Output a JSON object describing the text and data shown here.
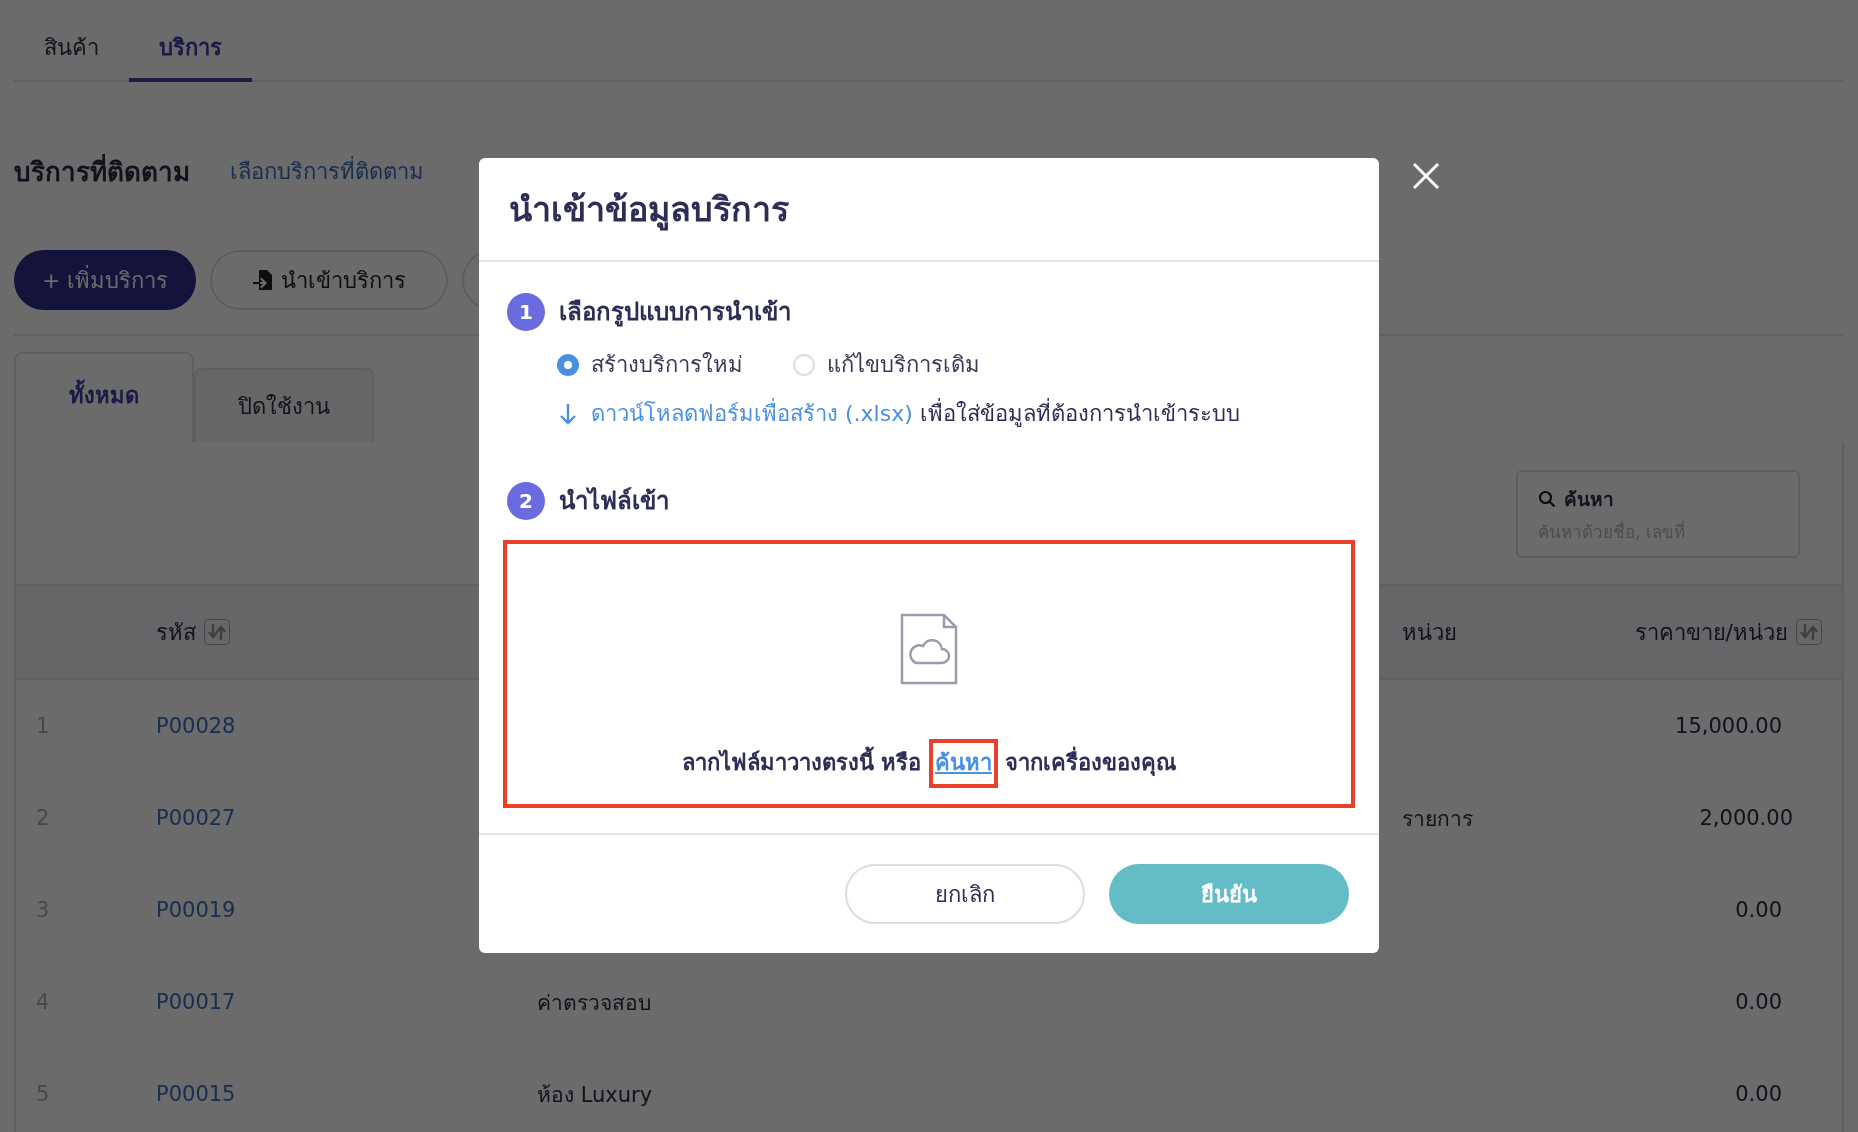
{
  "top_tabs": [
    {
      "label": "สินค้า",
      "selected": false
    },
    {
      "label": "บริการ",
      "selected": true
    }
  ],
  "section": {
    "title": "บริการที่ติดตาม",
    "link": "เลือกบริการที่ติดตาม"
  },
  "toolbar": {
    "add_button": {
      "icon": "+",
      "label": "เพิ่มบริการ"
    },
    "import_button": "นำเข้าบริการ"
  },
  "filter_tabs": [
    {
      "label": "ทั้งหมด",
      "selected": true
    },
    {
      "label": "ปิดใช้งาน",
      "selected": false
    }
  ],
  "search": {
    "label": "ค้นหา",
    "placeholder": "ค้นหาด้วยชื่อ, เลขที่"
  },
  "table": {
    "columns": [
      {
        "kind": "code",
        "label": "รหัส",
        "sortable": true
      },
      {
        "kind": "unit",
        "label": "หน่วย",
        "sortable": false
      },
      {
        "kind": "price",
        "label": "ราคาขาย/หน่วย",
        "sortable": true
      }
    ],
    "rows": [
      {
        "index": "1",
        "code": "P00028",
        "price": "15,000.00"
      },
      {
        "index": "2",
        "code": "P00027",
        "unit": "รายการ",
        "price": "2,000.00"
      },
      {
        "index": "3",
        "code": "P00019",
        "price": "0.00"
      },
      {
        "index": "4",
        "code": "P00017",
        "name": "ค่าตรวจสอบ",
        "price": "0.00"
      },
      {
        "index": "5",
        "code": "P00015",
        "name": "ห้อง Luxury",
        "price": "0.00"
      }
    ]
  },
  "modal": {
    "title": "นำเข้าข้อมูลบริการ",
    "steps": [
      {
        "number": "1",
        "title": "เลือกรูปแบบการนำเข้า"
      },
      {
        "number": "2",
        "title": "นำไฟล์เข้า"
      }
    ],
    "options": [
      {
        "label": "สร้างบริการใหม่",
        "selected": true
      },
      {
        "label": "แก้ไขบริการเดิม",
        "selected": false
      }
    ],
    "download": {
      "link": "ดาวน์โหลดฟอร์มเพื่อสร้าง (.xlsx)",
      "text": "เพื่อใส่ข้อมูลที่ต้องการนำเข้าระบบ"
    },
    "dropzone": {
      "text_before": "ลากไฟล์มาวางตรงนี้ หรือ",
      "link": "ค้นหา",
      "text_after": "จากเครื่องของคุณ"
    },
    "buttons": {
      "cancel": "ยกเลิก",
      "confirm": "ยืนยัน"
    }
  },
  "highlights": {
    "dropzone": true,
    "browse_link": true
  }
}
